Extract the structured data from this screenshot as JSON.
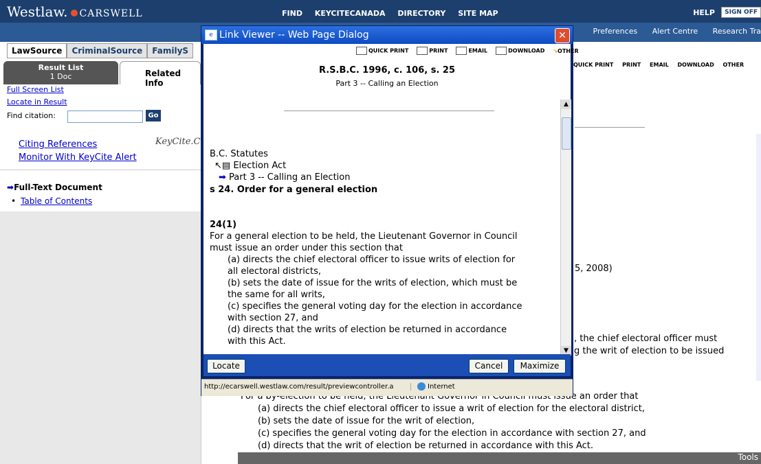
{
  "header": {
    "brand": "Westlaw.",
    "brand_sub": "CARSWELL",
    "nav": [
      "FIND",
      "KEYCITECANADA",
      "DIRECTORY",
      "SITE MAP"
    ],
    "help": "HELP",
    "signoff": "SIGN OFF",
    "subnav": [
      "Preferences",
      "Alert Centre",
      "Research Tra"
    ]
  },
  "tabs": [
    "LawSource",
    "CriminalSource",
    "FamilyS"
  ],
  "left": {
    "result_list": "Result List",
    "result_count": "1 Doc",
    "related_info": "Related Info",
    "full_screen_list": "Full Screen List",
    "locate_in_result": "Locate in Result",
    "find_citation_label": "Find citation:",
    "find_citation_value": "",
    "go": "Go",
    "citing_references": "Citing References",
    "monitor_keycite": "Monitor With KeyCite Alert",
    "keycite_logo": "KeyCite.Car",
    "full_text_document": "Full-Text Document",
    "table_of_contents": "Table of Contents"
  },
  "doc": {
    "toolbar": [
      "QUICK PRINT",
      "PRINT",
      "EMAIL",
      "DOWNLOAD",
      "OTHER"
    ],
    "frag1": "5, 2008)",
    "frag2": ", the chief electoral officer must",
    "frag3": "g the writ of election to be issued",
    "lines": [
      "For a by-election to be held, the Lieutenant Governor in Council must issue an order that",
      "(a) directs the chief electoral officer to issue a writ of election for the electoral district,",
      "(b) sets the date of issue for the writ of election,",
      "(c) specifies the general voting day for the election in accordance with section 27, and",
      "(d) directs that the writ of election be returned in accordance with this Act."
    ],
    "tools": "Tools"
  },
  "dialog": {
    "title": "Link Viewer -- Web Page Dialog",
    "toolbar": [
      "QUICK PRINT",
      "PRINT",
      "EMAIL",
      "DOWNLOAD",
      "OTHER"
    ],
    "citation": "R.S.B.C. 1996, c. 106, s. 25",
    "citation_sub": "Part 3 -- Calling an Election",
    "breadcrumb_root": "B.C. Statutes",
    "breadcrumb_act": "Election Act",
    "breadcrumb_part": "Part 3 -- Calling an Election",
    "section_heading": "s 24. Order for a general election",
    "subsection": "24(1)",
    "body": [
      "For a general election to be held, the Lieutenant Governor in Council",
      "must issue an order under this section that",
      "(a) directs the chief electoral officer to issue writs of election for",
      "all electoral districts,",
      "(b) sets the date of issue for the writs of election, which must be",
      "the same for all writs,",
      "(c) specifies the general voting day for the election in accordance",
      "with section 27, and",
      "(d) directs that the writs of election be returned in accordance",
      "with this Act."
    ],
    "buttons": {
      "locate": "Locate",
      "cancel": "Cancel",
      "maximize": "Maximize"
    },
    "status_url": "http://ecarswell.westlaw.com/result/previewcontroller.a",
    "status_zone": "Internet"
  }
}
